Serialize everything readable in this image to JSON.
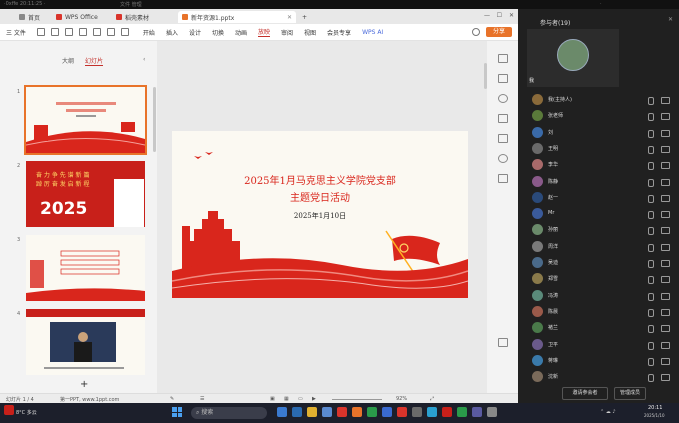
{
  "topstrip": {
    "left_text": "·0xffe  20:11:25  ·",
    "mid_text": "文件  管理",
    "right_text": "·"
  },
  "wps": {
    "tabs": [
      {
        "label": "首页",
        "color": "#888888"
      },
      {
        "label": "WPS Office",
        "color": "#d9342b"
      },
      {
        "label": "稻壳素材",
        "color": "#d9342b"
      },
      {
        "label": "新年资源1.pptx",
        "color": "#e8732a"
      }
    ],
    "new_tab": "+",
    "menubar": {
      "file_label": "三 文件",
      "items": [
        "开始",
        "插入",
        "设计",
        "切换",
        "动画",
        "放映",
        "审阅",
        "视图",
        "会员专享",
        "WPS AI"
      ],
      "active_index": 5,
      "share_label": "分享"
    },
    "left_panel": {
      "tabs": [
        "大纲",
        "幻灯片"
      ],
      "active_tab": 1,
      "slide_numbers": [
        "1",
        "2",
        "3",
        "4"
      ],
      "add_label": "+"
    },
    "thumb2": {
      "text1": "奋 力 争 先 谱 新 篇",
      "text2": "踔 厉 奋 发 启 新 程",
      "year": "2025"
    },
    "slide": {
      "title_line1": "2025年1月马克思主义学院党支部",
      "title_line2": "主题党日活动",
      "date": "2025年1月10日"
    },
    "status": {
      "slide_info": "幻灯片 1 / 4",
      "theme": "第一PPT, www.1ppt.com",
      "zoom": "92%"
    }
  },
  "meeting": {
    "header": "参与者(19)",
    "self_label": "我",
    "participants": [
      {
        "name": "我(主持人)",
        "color": "#8a6a3a"
      },
      {
        "name": "张老师",
        "color": "#5a7a3a"
      },
      {
        "name": "刘",
        "color": "#3a6aa8"
      },
      {
        "name": "王明",
        "color": "#6a6a6a"
      },
      {
        "name": "李华",
        "color": "#a86a6a"
      },
      {
        "name": "陈静",
        "color": "#8a5a8a"
      },
      {
        "name": "赵一",
        "color": "#2a4a7a"
      },
      {
        "name": "Mr",
        "color": "#3a5a9a"
      },
      {
        "name": "孙丽",
        "color": "#6a8a6a"
      },
      {
        "name": "周洋",
        "color": "#7a7a7a"
      },
      {
        "name": "吴迪",
        "color": "#4a6a8a"
      },
      {
        "name": "郑雪",
        "color": "#8a7a4a"
      },
      {
        "name": "冯涛",
        "color": "#5a8a7a"
      },
      {
        "name": "陈晨",
        "color": "#9a5a4a"
      },
      {
        "name": "褚兰",
        "color": "#4a7a4a"
      },
      {
        "name": "卫平",
        "color": "#6a5a8a"
      },
      {
        "name": "蒋琳",
        "color": "#3a7aaa"
      },
      {
        "name": "沈新",
        "color": "#7a6a5a"
      }
    ],
    "buttons": [
      "邀请参会者",
      "管理成员"
    ]
  },
  "taskbar": {
    "weather": "8°C 多云",
    "search_placeholder": "搜索",
    "time": "20:11",
    "date": "2025/1/10"
  }
}
